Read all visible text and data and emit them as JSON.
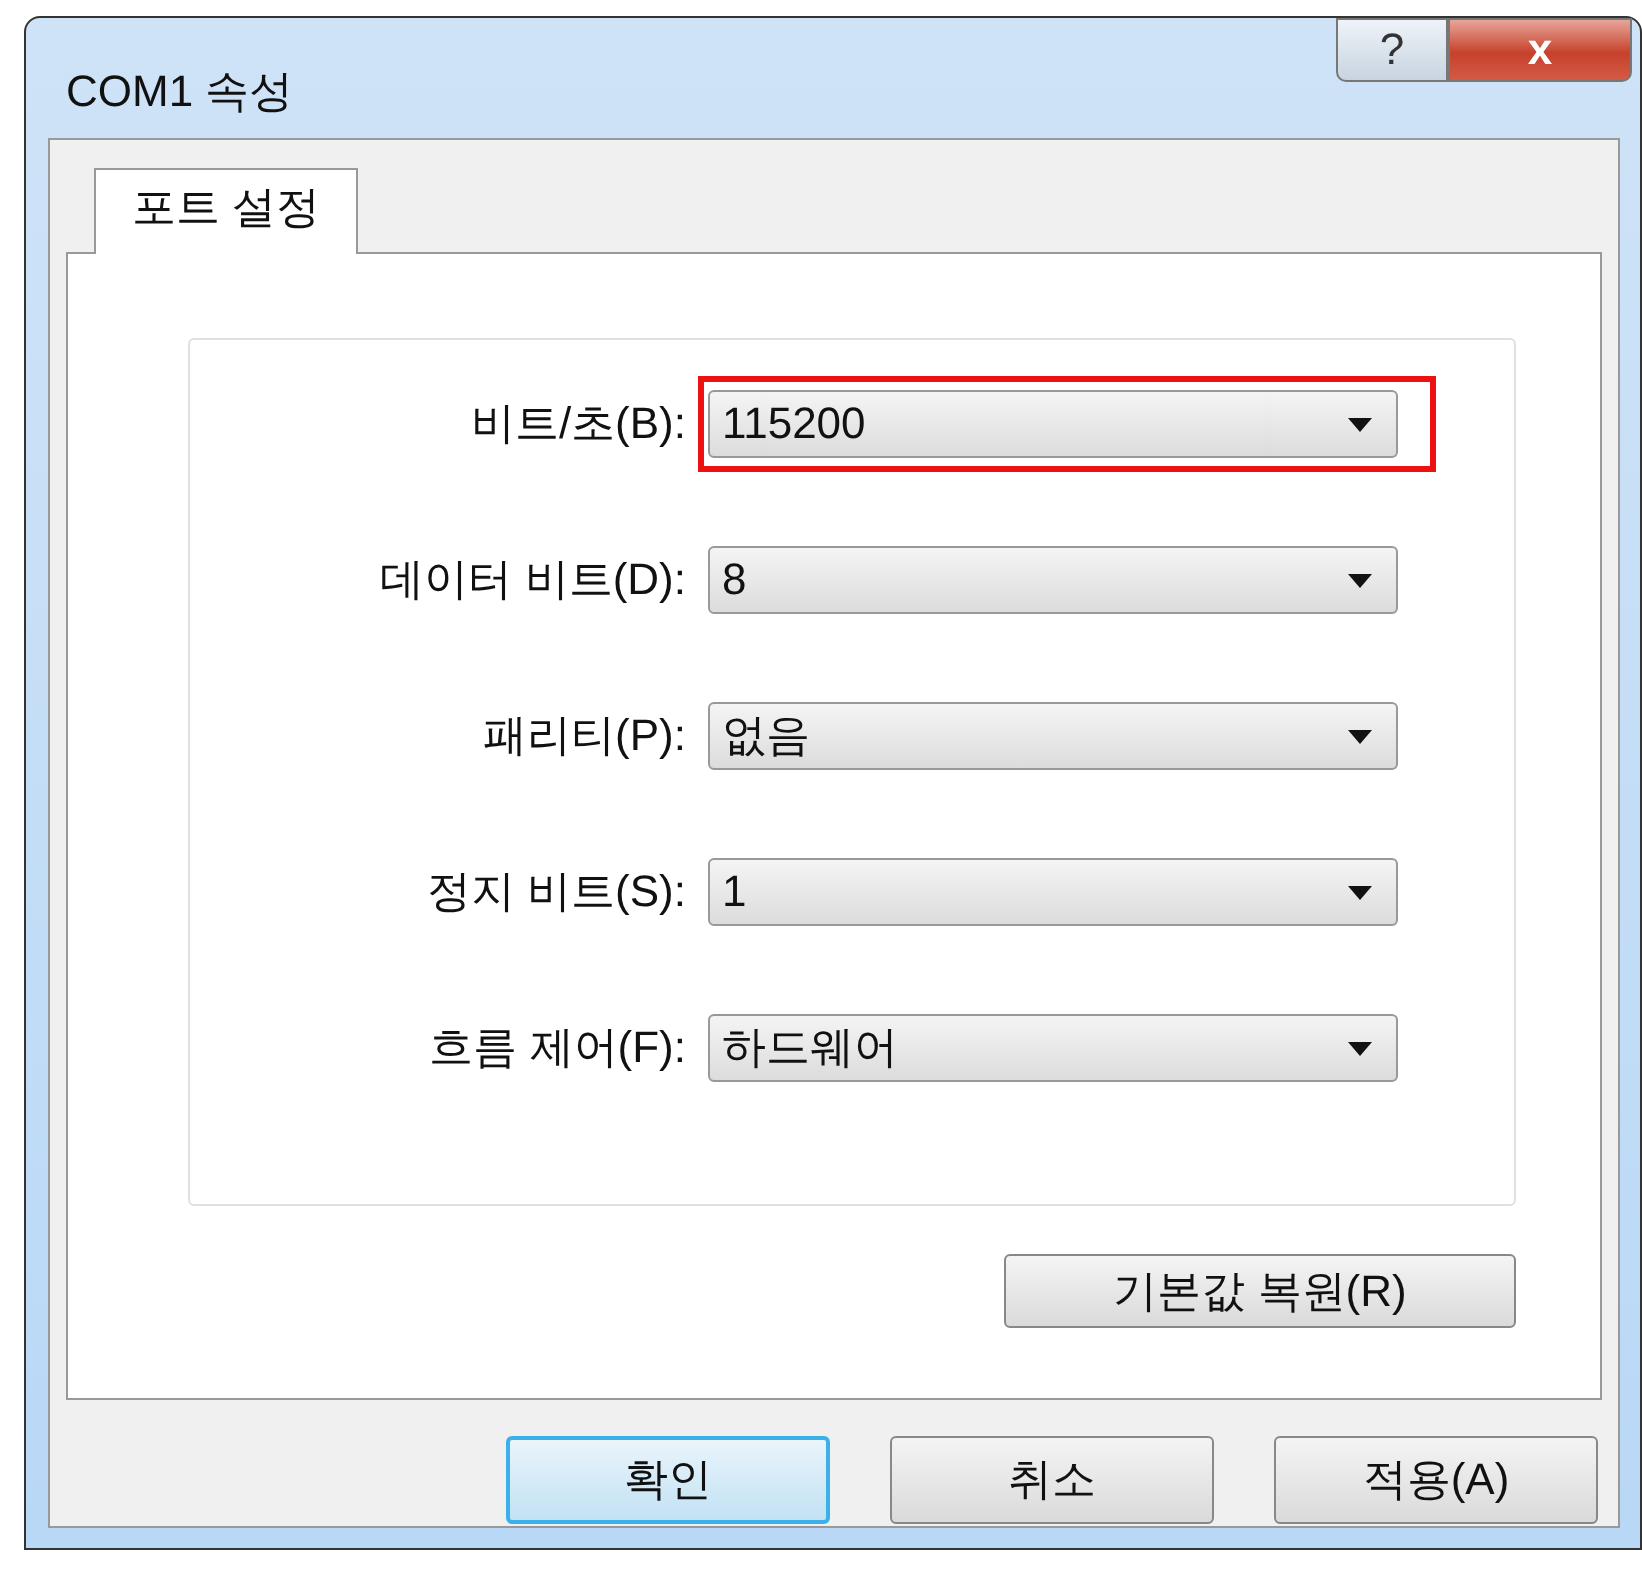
{
  "window": {
    "title": "COM1 속성",
    "title_buttons": [
      {
        "kind": "help",
        "label": "?"
      },
      {
        "kind": "close",
        "label": "x"
      }
    ]
  },
  "tabs": [
    {
      "label": "포트 설정",
      "selected": true
    }
  ],
  "fields": [
    {
      "label": "비트/초(B):",
      "value": "115200",
      "highlighted": true
    },
    {
      "label": "데이터 비트(D):",
      "value": "8",
      "highlighted": false
    },
    {
      "label": "패리티(P):",
      "value": "없음",
      "highlighted": false
    },
    {
      "label": "정지 비트(S):",
      "value": "1",
      "highlighted": false
    },
    {
      "label": "흐름 제어(F):",
      "value": "하드웨어",
      "highlighted": false
    }
  ],
  "restore_button": "기본값 복원(R)",
  "buttons": [
    {
      "label": "확인",
      "default": true
    },
    {
      "label": "취소",
      "default": false
    },
    {
      "label": "적용(A)",
      "default": false
    }
  ]
}
